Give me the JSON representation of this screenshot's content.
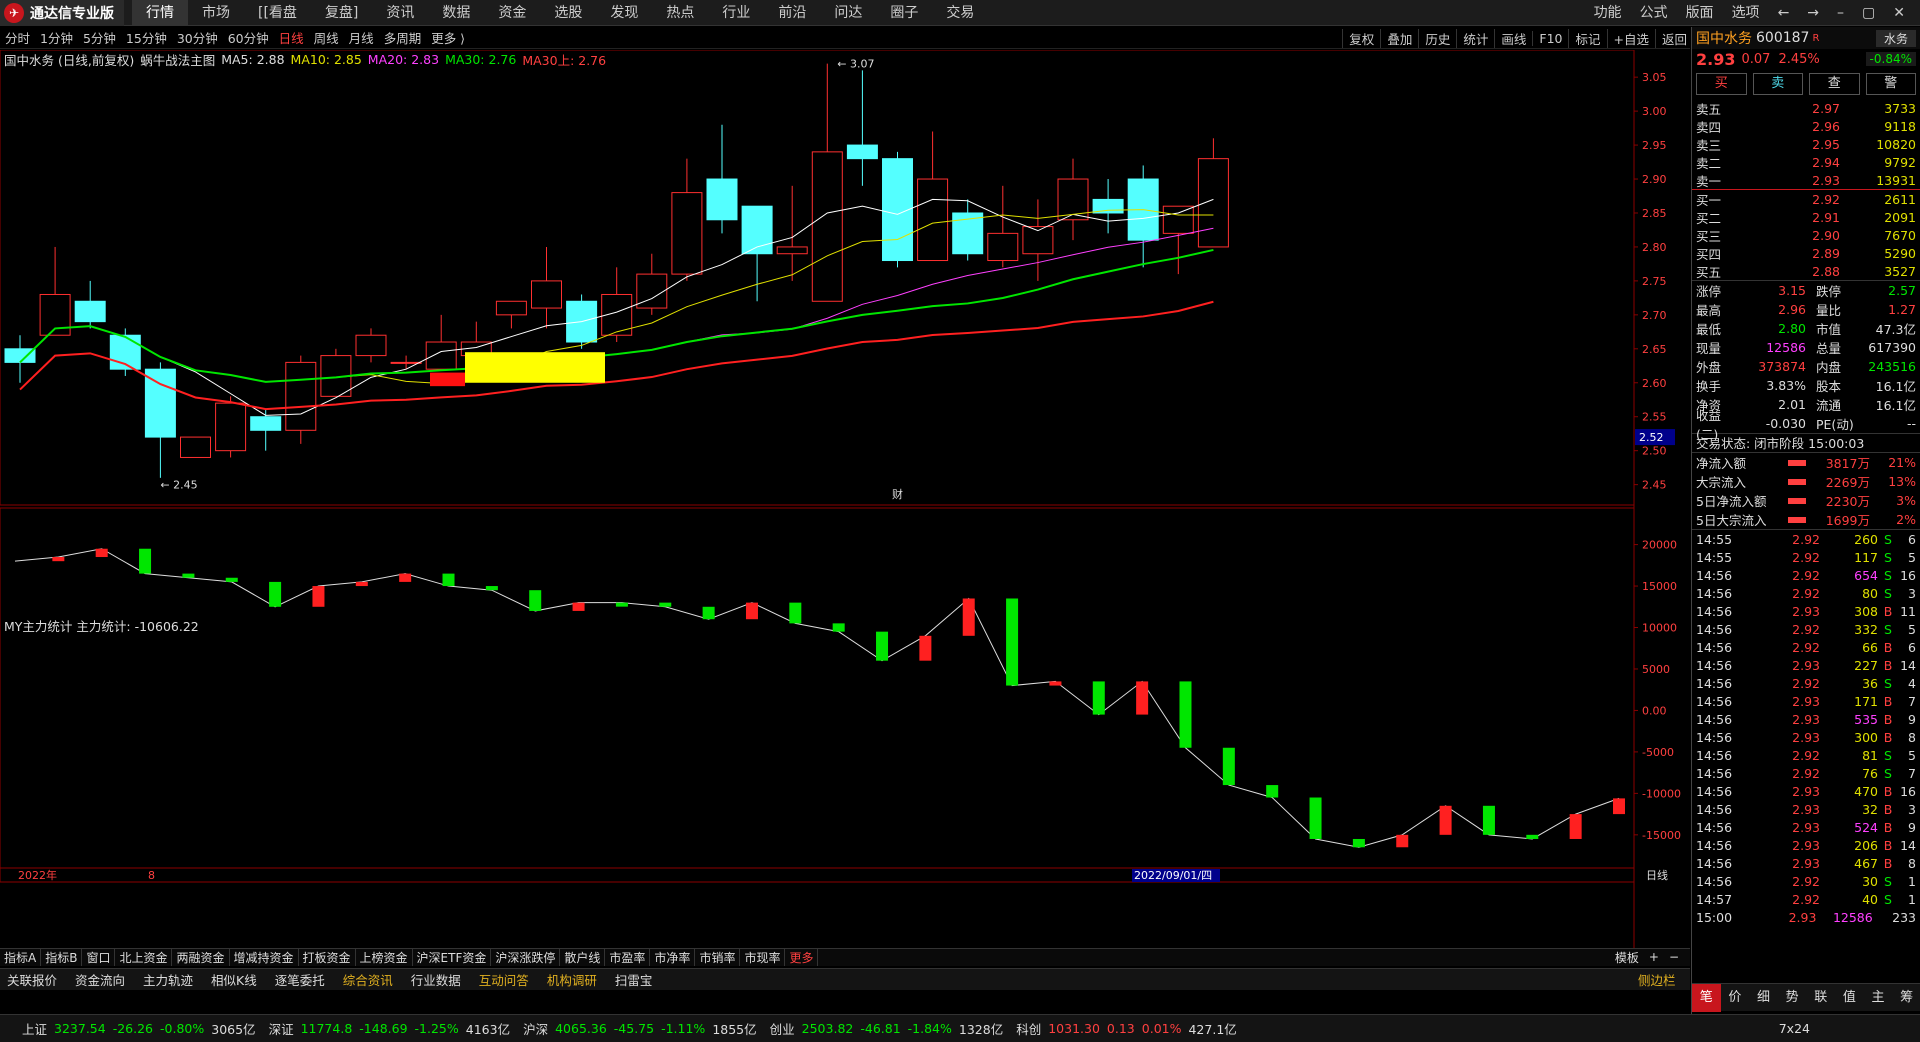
{
  "app": {
    "title": "通达信专业版"
  },
  "menu": [
    "行情",
    "市场",
    "[[看盘",
    "复盘]",
    "资讯",
    "数据",
    "资金",
    "选股",
    "发现",
    "热点",
    "行业",
    "前沿",
    "问达",
    "圈子",
    "交易"
  ],
  "topright": [
    "功能",
    "公式",
    "版面",
    "选项",
    "←",
    "→",
    "–",
    "▢",
    "✕"
  ],
  "periods": [
    "分时",
    "1分钟",
    "5分钟",
    "15分钟",
    "30分钟",
    "60分钟",
    "日线",
    "周线",
    "月线",
    "多周期",
    "更多 ⟩"
  ],
  "tools": [
    "复权",
    "叠加",
    "历史",
    "统计",
    "画线",
    "F10",
    "标记",
    "+自选",
    "返回"
  ],
  "main_header": {
    "name": "国中水务 (日线,前复权)",
    "indicator": "蜗牛战法主图",
    "ma5": "MA5: 2.88",
    "ma10": "MA10: 2.85",
    "ma20": "MA20: 2.83",
    "ma30": "MA30: 2.76",
    "ma30l": "MA30上: 2.76"
  },
  "sub_header": "MY主力统计 主力统计: -10606.22",
  "idx_tabs": [
    "指标A",
    "指标B",
    "窗口",
    "北上资金",
    "两融资金",
    "增减持资金",
    "打板资金",
    "上榜资金",
    "沪深ETF资金",
    "沪深涨跌停",
    "散户线",
    "市盈率",
    "市净率",
    "市销率",
    "市现率",
    "更多"
  ],
  "idx_right": [
    "模板",
    "+",
    "−"
  ],
  "func_tabs": [
    "关联报价",
    "资金流向",
    "主力轨迹",
    "相似K线",
    "逐笔委托",
    "综合资讯",
    "行业数据",
    "互动问答",
    "机构调研",
    "扫雷宝"
  ],
  "sidebar_label": "侧边栏",
  "status": [
    {
      "name": "上证",
      "price": "3237.54",
      "chg": "-26.26",
      "pct": "-0.80%",
      "amt": "3065亿"
    },
    {
      "name": "深证",
      "price": "11774.8",
      "chg": "-148.69",
      "pct": "-1.25%",
      "amt": "4163亿"
    },
    {
      "name": "沪深",
      "price": "4065.36",
      "chg": "-45.75",
      "pct": "-1.11%",
      "amt": "1855亿"
    },
    {
      "name": "创业",
      "price": "2503.82",
      "chg": "-46.81",
      "pct": "-1.84%",
      "amt": "1328亿"
    },
    {
      "name": "科创",
      "price": "1031.30",
      "chg": "0.13",
      "pct": "0.01%",
      "amt": "427.1亿"
    }
  ],
  "status_right": "7x24",
  "quote": {
    "name": "国中水务",
    "code": "600187",
    "tag": "R",
    "price": "2.93",
    "chg": "0.07",
    "pct": "2.45%",
    "sector": "水务",
    "sector_pct": "-0.84%",
    "buttons": [
      "买",
      "卖",
      "查",
      "警"
    ],
    "asks": [
      {
        "l": "卖五",
        "p": "2.97",
        "v": "3733"
      },
      {
        "l": "卖四",
        "p": "2.96",
        "v": "9118"
      },
      {
        "l": "卖三",
        "p": "2.95",
        "v": "10820"
      },
      {
        "l": "卖二",
        "p": "2.94",
        "v": "9792"
      },
      {
        "l": "卖一",
        "p": "2.93",
        "v": "13931"
      }
    ],
    "bids": [
      {
        "l": "买一",
        "p": "2.92",
        "v": "2611"
      },
      {
        "l": "买二",
        "p": "2.91",
        "v": "2091"
      },
      {
        "l": "买三",
        "p": "2.90",
        "v": "7670"
      },
      {
        "l": "买四",
        "p": "2.89",
        "v": "5290"
      },
      {
        "l": "买五",
        "p": "2.88",
        "v": "3527"
      }
    ],
    "stats": [
      {
        "k": "涨停",
        "v": "3.15",
        "k2": "跌停",
        "v2": "2.57",
        "c1": "r",
        "c2": "g"
      },
      {
        "k": "最高",
        "v": "2.96",
        "k2": "量比",
        "v2": "1.27",
        "c1": "r",
        "c2": "r"
      },
      {
        "k": "最低",
        "v": "2.80",
        "k2": "市值",
        "v2": "47.3亿",
        "c1": "g",
        "c2": "w"
      },
      {
        "k": "现量",
        "v": "12586",
        "k2": "总量",
        "v2": "617390",
        "c1": "m",
        "c2": "w"
      },
      {
        "k": "外盘",
        "v": "373874",
        "k2": "内盘",
        "v2": "243516",
        "c1": "r",
        "c2": "g"
      },
      {
        "k": "换手",
        "v": "3.83%",
        "k2": "股本",
        "v2": "16.1亿",
        "c1": "w",
        "c2": "w"
      },
      {
        "k": "净资",
        "v": "2.01",
        "k2": "流通",
        "v2": "16.1亿",
        "c1": "w",
        "c2": "w"
      },
      {
        "k": "收益(二)",
        "v": "-0.030",
        "k2": "PE(动)",
        "v2": "--",
        "c1": "w",
        "c2": "w"
      }
    ],
    "trade_state": "交易状态: 闭市阶段 15:00:03",
    "flows": [
      {
        "k": "净流入额",
        "v": "3817万",
        "p": "21%"
      },
      {
        "k": "大宗流入",
        "v": "2269万",
        "p": "13%"
      },
      {
        "k": "5日净流入额",
        "v": "2230万",
        "p": "3%"
      },
      {
        "k": "5日大宗流入",
        "v": "1699万",
        "p": "2%"
      }
    ],
    "ticks": [
      {
        "t": "14:55",
        "p": "2.92",
        "v": "260",
        "s": "S",
        "n": "6"
      },
      {
        "t": "14:55",
        "p": "2.92",
        "v": "117",
        "s": "S",
        "n": "5"
      },
      {
        "t": "14:56",
        "p": "2.92",
        "v": "654",
        "s": "S",
        "n": "16"
      },
      {
        "t": "14:56",
        "p": "2.92",
        "v": "80",
        "s": "S",
        "n": "3"
      },
      {
        "t": "14:56",
        "p": "2.93",
        "v": "308",
        "s": "B",
        "n": "11"
      },
      {
        "t": "14:56",
        "p": "2.92",
        "v": "332",
        "s": "S",
        "n": "5"
      },
      {
        "t": "14:56",
        "p": "2.92",
        "v": "66",
        "s": "B",
        "n": "6"
      },
      {
        "t": "14:56",
        "p": "2.93",
        "v": "227",
        "s": "B",
        "n": "14"
      },
      {
        "t": "14:56",
        "p": "2.92",
        "v": "36",
        "s": "S",
        "n": "4"
      },
      {
        "t": "14:56",
        "p": "2.93",
        "v": "171",
        "s": "B",
        "n": "7"
      },
      {
        "t": "14:56",
        "p": "2.93",
        "v": "535",
        "s": "B",
        "n": "9"
      },
      {
        "t": "14:56",
        "p": "2.93",
        "v": "300",
        "s": "B",
        "n": "8"
      },
      {
        "t": "14:56",
        "p": "2.92",
        "v": "81",
        "s": "S",
        "n": "5"
      },
      {
        "t": "14:56",
        "p": "2.92",
        "v": "76",
        "s": "S",
        "n": "7"
      },
      {
        "t": "14:56",
        "p": "2.93",
        "v": "470",
        "s": "B",
        "n": "16"
      },
      {
        "t": "14:56",
        "p": "2.93",
        "v": "32",
        "s": "B",
        "n": "3"
      },
      {
        "t": "14:56",
        "p": "2.93",
        "v": "524",
        "s": "B",
        "n": "9"
      },
      {
        "t": "14:56",
        "p": "2.93",
        "v": "206",
        "s": "B",
        "n": "14"
      },
      {
        "t": "14:56",
        "p": "2.93",
        "v": "467",
        "s": "B",
        "n": "8"
      },
      {
        "t": "14:56",
        "p": "2.92",
        "v": "30",
        "s": "S",
        "n": "1"
      },
      {
        "t": "14:57",
        "p": "2.92",
        "v": "40",
        "s": "S",
        "n": "1"
      },
      {
        "t": "15:00",
        "p": "2.93",
        "v": "12586",
        "s": "",
        "n": "233"
      }
    ],
    "tabs": [
      "笔",
      "价",
      "细",
      "势",
      "联",
      "值",
      "主",
      "筹"
    ]
  },
  "chart_data": {
    "type": "candlestick",
    "y_ticks": [
      "3.05",
      "3.00",
      "2.95",
      "2.90",
      "2.85",
      "2.80",
      "2.75",
      "2.70",
      "2.65",
      "2.60",
      "2.55",
      "2.50",
      "2.45"
    ],
    "y_min": 2.42,
    "y_max": 3.09,
    "current_price_label": "2.52",
    "high_label": "3.07",
    "low_label": "2.45",
    "candles": [
      [
        2.65,
        2.63,
        2.67,
        2.6
      ],
      [
        2.67,
        2.73,
        2.8,
        2.67
      ],
      [
        2.72,
        2.69,
        2.75,
        2.68
      ],
      [
        2.67,
        2.62,
        2.68,
        2.61
      ],
      [
        2.62,
        2.52,
        2.63,
        2.46
      ],
      [
        2.49,
        2.52,
        2.52,
        2.49
      ],
      [
        2.5,
        2.57,
        2.58,
        2.49
      ],
      [
        2.55,
        2.53,
        2.56,
        2.5
      ],
      [
        2.53,
        2.63,
        2.64,
        2.51
      ],
      [
        2.58,
        2.64,
        2.65,
        2.58
      ],
      [
        2.64,
        2.67,
        2.68,
        2.63
      ],
      [
        2.63,
        2.63,
        2.64,
        2.62
      ],
      [
        2.62,
        2.66,
        2.7,
        2.62
      ],
      [
        2.64,
        2.66,
        2.69,
        2.62
      ],
      [
        2.7,
        2.72,
        2.72,
        2.68
      ],
      [
        2.71,
        2.75,
        2.8,
        2.68
      ],
      [
        2.72,
        2.66,
        2.73,
        2.65
      ],
      [
        2.67,
        2.73,
        2.77,
        2.66
      ],
      [
        2.71,
        2.76,
        2.79,
        2.7
      ],
      [
        2.76,
        2.88,
        2.93,
        2.75
      ],
      [
        2.9,
        2.84,
        2.98,
        2.82
      ],
      [
        2.86,
        2.79,
        2.86,
        2.72
      ],
      [
        2.79,
        2.8,
        2.89,
        2.75
      ],
      [
        2.72,
        2.94,
        3.07,
        2.72
      ],
      [
        2.95,
        2.93,
        3.06,
        2.89
      ],
      [
        2.93,
        2.78,
        2.94,
        2.77
      ],
      [
        2.78,
        2.9,
        2.97,
        2.78
      ],
      [
        2.85,
        2.79,
        2.87,
        2.78
      ],
      [
        2.78,
        2.82,
        2.89,
        2.77
      ],
      [
        2.79,
        2.83,
        2.87,
        2.75
      ],
      [
        2.84,
        2.9,
        2.93,
        2.81
      ],
      [
        2.87,
        2.85,
        2.9,
        2.82
      ],
      [
        2.9,
        2.81,
        2.92,
        2.77
      ],
      [
        2.82,
        2.86,
        2.86,
        2.76
      ],
      [
        2.8,
        2.93,
        2.96,
        2.8
      ]
    ],
    "sub_y_ticks": [
      "20000",
      "15000",
      "10000",
      "5000",
      "0.00",
      "-5000",
      "-10000",
      "-15000"
    ],
    "sub_values": [
      18000,
      18500,
      19500,
      16500,
      16000,
      15500,
      12500,
      15000,
      15500,
      16500,
      15000,
      14500,
      12000,
      13000,
      13000,
      12500,
      11000,
      13000,
      10500,
      9500,
      6000,
      9000,
      13500,
      3000,
      3500,
      -500,
      3500,
      -4500,
      -9000,
      -10500,
      -15500,
      -16500,
      -15000,
      -11500,
      -15000,
      -15500,
      -12500,
      -10606
    ],
    "x_labels": [
      "2022年",
      "8",
      "2022/09/01/四"
    ],
    "period_label": "日线",
    "finance_mark": "财"
  }
}
